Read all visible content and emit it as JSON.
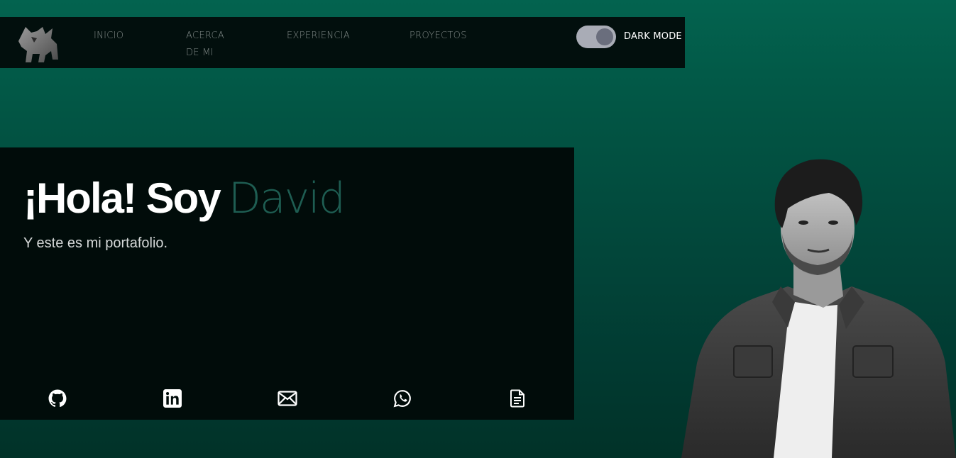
{
  "nav": {
    "logo_icon": "fox-logo-icon",
    "links": [
      {
        "label": "INICIO"
      },
      {
        "label": "ACERCA DE MI"
      },
      {
        "label": "EXPERIENCIA"
      },
      {
        "label": "PROYECTOS"
      }
    ],
    "dark_mode": {
      "label": "DARK MODE",
      "enabled": true
    }
  },
  "hero": {
    "greeting": "¡Hola! Soy",
    "name": "David",
    "subtitle": "Y este es mi portafolio."
  },
  "social": [
    {
      "icon": "github-icon"
    },
    {
      "icon": "linkedin-icon"
    },
    {
      "icon": "email-icon"
    },
    {
      "icon": "whatsapp-icon"
    },
    {
      "icon": "document-icon"
    }
  ],
  "colors": {
    "accent": "#1e5d52",
    "background_top": "#03634f",
    "background_bottom": "#013228",
    "panel": "#010c0a",
    "navbar": "#020f0d"
  }
}
